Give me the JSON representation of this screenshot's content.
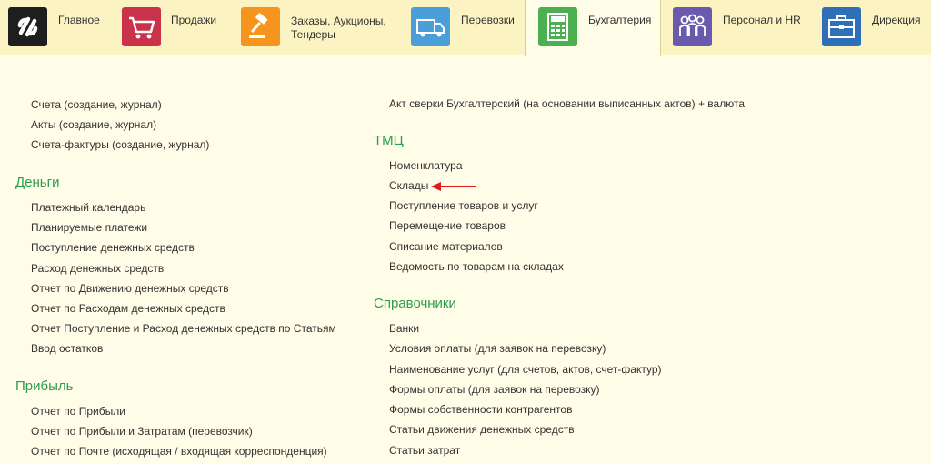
{
  "nav": {
    "tabs": [
      {
        "label": "Главное",
        "icon": "logo-icon",
        "color": "#1e1e1e"
      },
      {
        "label": "Продажи",
        "icon": "cart-icon",
        "color": "#c8334b"
      },
      {
        "label": "Заказы,  Аукционы,",
        "label2": "Тендеры",
        "icon": "gavel-icon",
        "color": "#f7941d"
      },
      {
        "label": "Перевозки",
        "icon": "truck-icon",
        "color": "#4b9fd8"
      },
      {
        "label": "Бухгалтерия",
        "icon": "calculator-icon",
        "color": "#4caf50",
        "active": true
      },
      {
        "label": "Персонал и HR",
        "icon": "people-icon",
        "color": "#6a5aad"
      },
      {
        "label": "Дирекция",
        "icon": "briefcase-icon",
        "color": "#2f6fb8"
      }
    ]
  },
  "left": {
    "top_links": [
      "Счета (создание, журнал)",
      "Акты (создание, журнал)",
      "Счета-фактуры (создание, журнал)"
    ],
    "money": {
      "title": "Деньги",
      "links": [
        "Платежный календарь",
        "Планируемые платежи",
        "Поступление денежных средств",
        "Расход денежных средств",
        "Отчет по Движению денежных средств",
        "Отчет по Расходам денежных средств",
        "Отчет Поступление и Расход денежных средств по Статьям",
        "Ввод остатков"
      ]
    },
    "profit": {
      "title": "Прибыль",
      "links": [
        "Отчет по Прибыли",
        "Отчет по Прибыли и Затратам (перевозчик)",
        "Отчет по Почте (исходящая / входящая корреспонденция)"
      ]
    }
  },
  "right": {
    "top_links": [
      "Акт сверки Бухгалтерский (на основании выписанных актов) + валюта"
    ],
    "tmc": {
      "title": "ТМЦ",
      "links": [
        "Номенклатура",
        "Склады",
        "Поступление товаров и услуг",
        "Перемещение товаров",
        "Списание материалов",
        "Ведомость по товарам на складах"
      ]
    },
    "refs": {
      "title": "Справочники",
      "links": [
        "Банки",
        "Условия оплаты (для заявок на перевозку)",
        "Наименование услуг (для счетов, актов, счет-фактур)",
        "Формы оплаты (для заявок на перевозку)",
        "Формы собственности контрагентов",
        "Статьи движения денежных средств",
        "Статьи затрат"
      ]
    }
  },
  "annotation": {
    "arrow_color": "#e01b1b",
    "target": "Склады"
  }
}
